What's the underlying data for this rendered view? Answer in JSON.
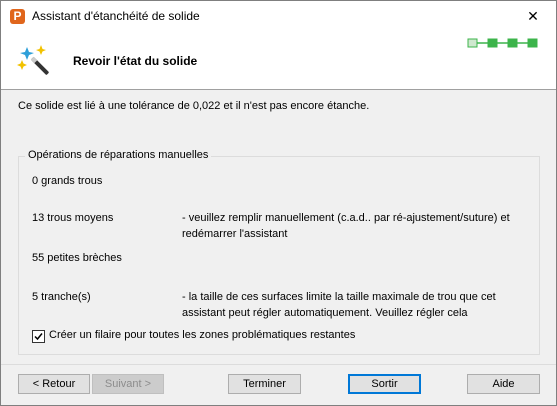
{
  "window": {
    "title": "Assistant d'étanchéité de solide",
    "app_icon": "P",
    "close_glyph": "✕"
  },
  "header": {
    "title": "Revoir l'état du solide",
    "icon": "wizard-wand-icon"
  },
  "status": {
    "text": "Ce solide est lié à une tolérance de 0,022 et il n'est pas encore étanche."
  },
  "group": {
    "legend": "Opérations de réparations manuelles",
    "rows": [
      {
        "label": "0 grands trous",
        "desc": ""
      },
      {
        "label": "13 trous moyens",
        "desc": "- veuillez remplir manuellement (c.a.d.. par ré-ajustement/suture) et redémarrer l'assistant"
      },
      {
        "label": "55 petites brèches",
        "desc": ""
      },
      {
        "label": "5 tranche(s)",
        "desc": "- la taille de ces surfaces limite la taille maximale de trou que cet assistant peut régler automatiquement. Veuillez régler cela"
      }
    ],
    "checkbox": {
      "label": "Créer un filaire pour toutes les zones problématiques restantes",
      "checked": true
    }
  },
  "buttons": {
    "back": "< Retour",
    "next": "Suivant >",
    "finish": "Terminer",
    "exit": "Sortir",
    "help": "Aide"
  },
  "colors": {
    "accent": "#0078d7",
    "progress": "#3cb44b",
    "icon_orange": "#e0661c"
  }
}
